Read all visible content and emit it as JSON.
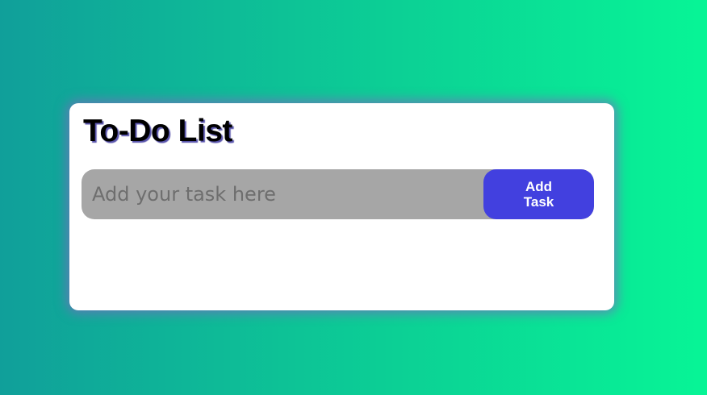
{
  "app": {
    "title": "To-Do List"
  },
  "form": {
    "input_placeholder": "Add your task here",
    "input_value": "",
    "add_button_label": "Add Task"
  },
  "tasks": [],
  "colors": {
    "background_gradient_start": "#109f9a",
    "background_gradient_end": "#07f596",
    "card": "#ffffff",
    "input_background": "#a6a6a6",
    "button": "#4240df",
    "button_text": "#ffffff",
    "title_shadow": "#5a55ad"
  }
}
